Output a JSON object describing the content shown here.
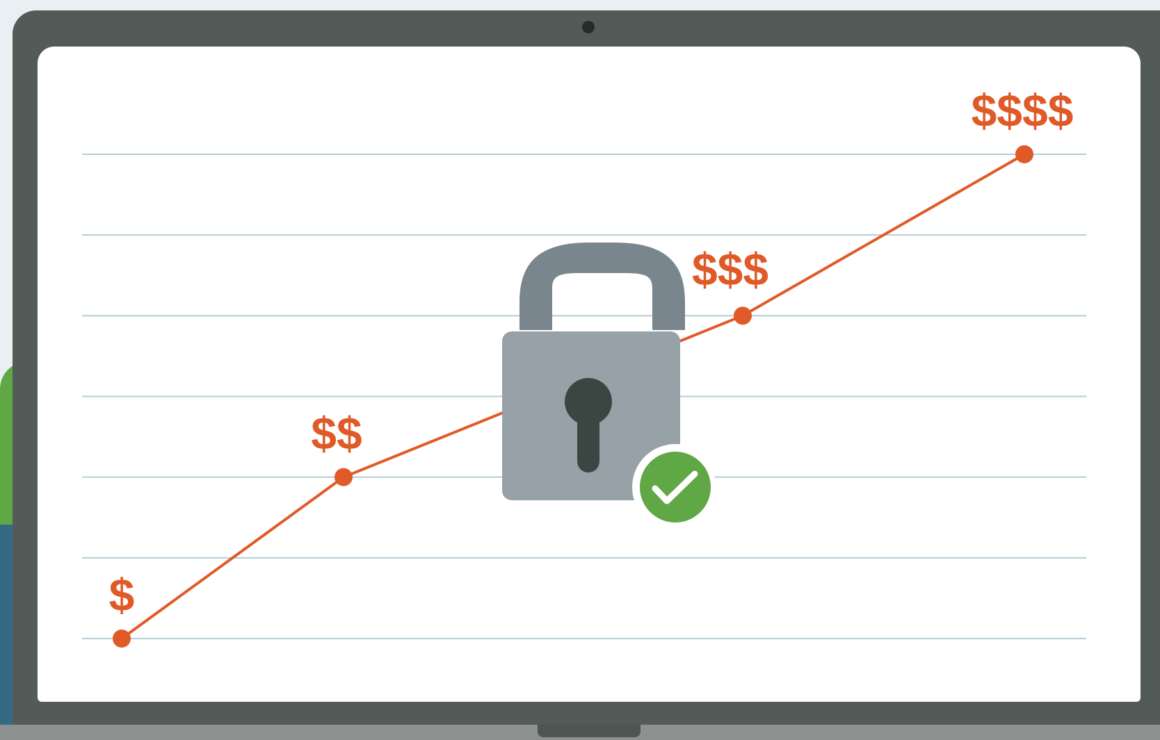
{
  "chart_data": {
    "type": "line",
    "x": [
      1,
      2,
      3,
      4
    ],
    "values": [
      0,
      2,
      4,
      6
    ],
    "point_labels": [
      "$",
      "$$",
      "$$$",
      "$$$$"
    ],
    "ylim": [
      0,
      6
    ],
    "grid": true,
    "colors": {
      "line": "#e05a28",
      "grid": "#b5ccd6"
    }
  },
  "icons": {
    "lock": "padlock-icon",
    "check": "check-circle-icon",
    "camera": "webcam-icon"
  },
  "colors": {
    "frame": "#535b58",
    "lock_body": "#96a1a8",
    "lock_shackle": "#7a868e",
    "keyhole": "#3b4643",
    "check": "#5fa845"
  }
}
